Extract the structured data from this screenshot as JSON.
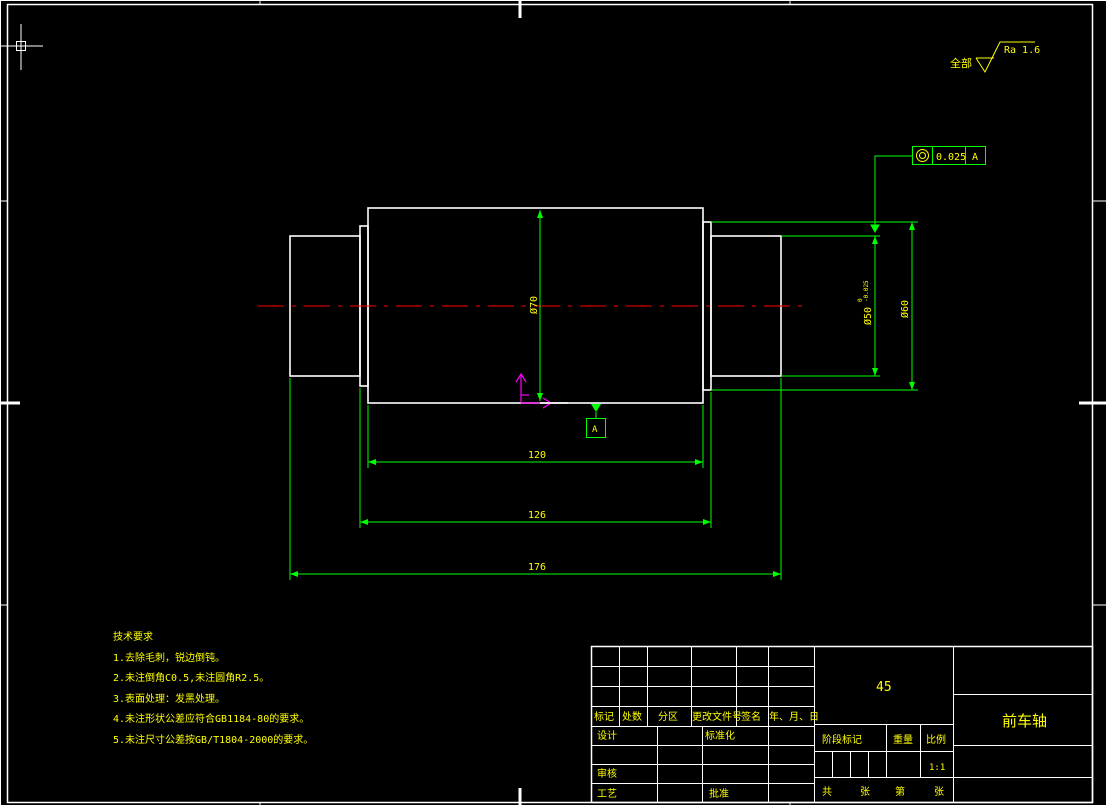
{
  "colors": {
    "background": "#000000",
    "part_outline": "#ffffff",
    "dimension": "#00ff00",
    "text": "#ffff00",
    "centerline": "#ff0000",
    "ucs_icon": "#ff00ff"
  },
  "surface_finish": {
    "prefix": "全部",
    "value": "Ra 1.6"
  },
  "geometric_tolerance": {
    "symbol": "concentricity",
    "value": "0.025",
    "datum": "A"
  },
  "datum_feature": {
    "label": "A"
  },
  "dimensions": {
    "dia_main": "Ø70",
    "dia_shoulder": "Ø60",
    "dia_end": "Ø50",
    "dia_end_upper_tol": "0",
    "dia_end_lower_tol": "-0.025",
    "length_main": "120",
    "length_mid": "126",
    "length_total": "176"
  },
  "technical_requirements": {
    "title": "技术要求",
    "items": [
      "1.去除毛刺，锐边倒钝。",
      "2.未注倒角C0.5,未注圆角R2.5。",
      "3.表面处理：发黑处理。",
      "4.未注形状公差应符合GB1184-80的要求。",
      "5.未注尺寸公差按GB/T1804-2000的要求。"
    ]
  },
  "title_block": {
    "material": "45",
    "part_name": "前车轴",
    "revision_headers": [
      "标记",
      "处数",
      "分区",
      "更改文件号",
      "签名",
      "年、月、日"
    ],
    "design_label": "设计",
    "standardization_label": "标准化",
    "review_label": "审核",
    "process_label": "工艺",
    "approve_label": "批准",
    "stage_mark_label": "阶段标记",
    "weight_label": "重量",
    "scale_label": "比例",
    "scale_value": "1:1",
    "sheets_total_label": "共",
    "sheets_unit_label": "张",
    "sheet_no_label": "第",
    "sheet_no_unit_label": "张"
  }
}
